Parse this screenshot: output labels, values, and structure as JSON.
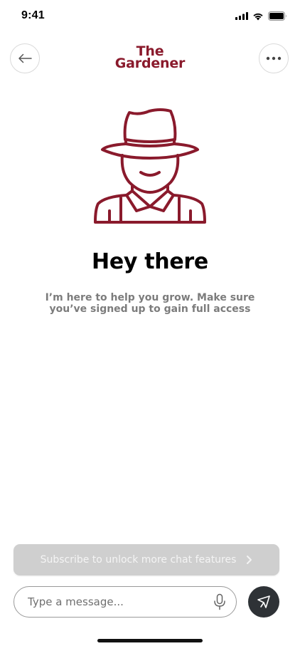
{
  "status_bar": {
    "time": "9:41"
  },
  "header": {
    "logo_line1": "The",
    "logo_line2": "Gardener",
    "back_icon": "arrow-left-icon",
    "more_icon": "more-horizontal-icon"
  },
  "colors": {
    "brand": "#8a1a2c",
    "banner_bg": "#cfcfcf",
    "send_button_bg": "#2e3236",
    "subtitle": "#7c7c7c"
  },
  "hero": {
    "illustration_icon": "gardener-hat-icon",
    "greeting": "Hey there",
    "subtitle": "I’m here to help you grow. Make sure you’ve signed up to gain full access"
  },
  "subscribe_banner": {
    "label": "Subscribe to unlock more chat features",
    "icon": "chevron-right-icon"
  },
  "composer": {
    "placeholder": "Type a message...",
    "mic_icon": "microphone-icon",
    "send_icon": "send-icon"
  }
}
